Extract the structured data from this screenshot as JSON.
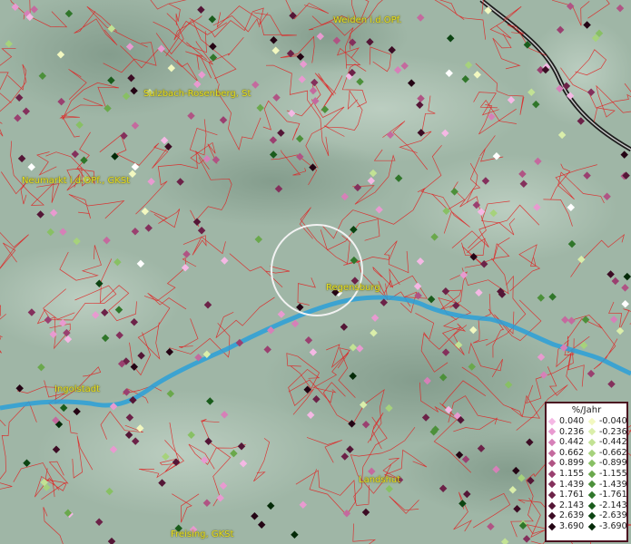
{
  "cities": [
    {
      "name": "Weiden i.d.OPf."
    },
    {
      "name": "Sulzbach-Rosenberg, St"
    },
    {
      "name": "Neumarkt i.d.OPf., GKSt"
    },
    {
      "name": "Regensburg"
    },
    {
      "name": "Ingolstadt"
    },
    {
      "name": "Landshut"
    },
    {
      "name": "Freising, GKSt"
    }
  ],
  "legend": {
    "title": "%/Jahr",
    "positive": [
      {
        "label": "0.040",
        "color": "#f4b8e4"
      },
      {
        "label": "0.236",
        "color": "#e89ad0"
      },
      {
        "label": "0.442",
        "color": "#d680b8"
      },
      {
        "label": "0.662",
        "color": "#c46a9e"
      },
      {
        "label": "0.899",
        "color": "#b05484"
      },
      {
        "label": "1.155",
        "color": "#9a4070"
      },
      {
        "label": "1.439",
        "color": "#84305c"
      },
      {
        "label": "1.761",
        "color": "#6c2248"
      },
      {
        "label": "2.143",
        "color": "#541636"
      },
      {
        "label": "2.639",
        "color": "#3c0c24"
      },
      {
        "label": "3.690",
        "color": "#240414"
      }
    ],
    "negative": [
      {
        "label": "-0.040",
        "color": "#f2f8c0"
      },
      {
        "label": "-0.236",
        "color": "#daeeaa"
      },
      {
        "label": "-0.442",
        "color": "#c2e294"
      },
      {
        "label": "-0.662",
        "color": "#a6d27c"
      },
      {
        "label": "-0.899",
        "color": "#88c064"
      },
      {
        "label": "-1.155",
        "color": "#6aa84c"
      },
      {
        "label": "-1.439",
        "color": "#4c903a"
      },
      {
        "label": "-1.761",
        "color": "#30762a"
      },
      {
        "label": "-2.143",
        "color": "#1a5c1c"
      },
      {
        "label": "-2.639",
        "color": "#0c4412"
      },
      {
        "label": "-3.690",
        "color": "#042a08"
      }
    ]
  },
  "colors": {
    "border": "#e02020",
    "river": "#2aa0d8",
    "terrain": "#9cb4a4",
    "label": "#e8e020"
  }
}
